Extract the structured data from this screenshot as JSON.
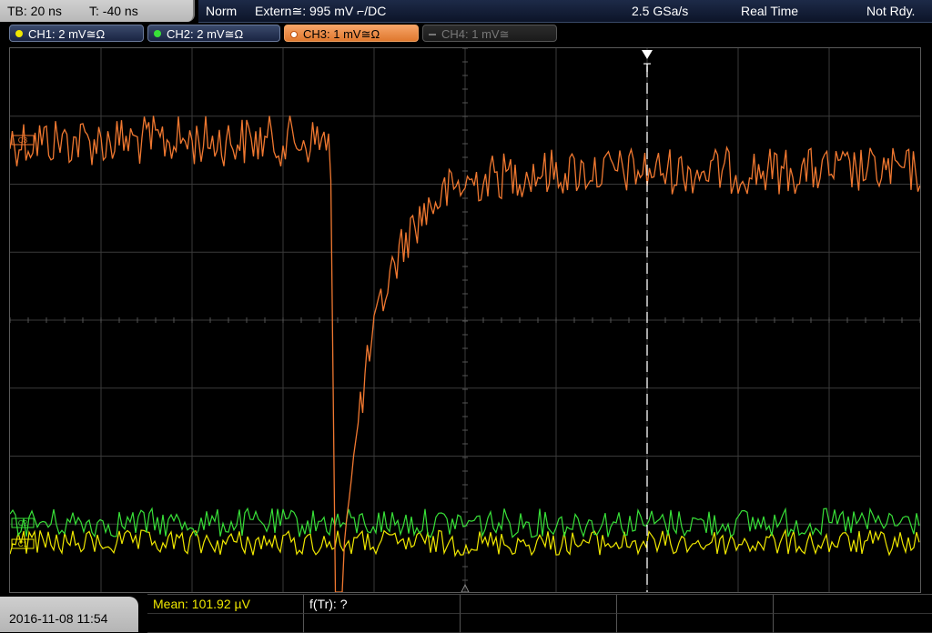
{
  "topbar": {
    "tb_label": "TB: 20 ns",
    "t_label": "T: -40 ns",
    "trigger_mode": "Norm",
    "trigger_source": "Extern≅: 995 mV ⌐/DC",
    "sample_rate": "2.5 GSa/s",
    "acq_mode": "Real Time",
    "status": "Not Rdy."
  },
  "channels": [
    {
      "label": "CH1: 2 mV≅Ω",
      "color": "#f0e800",
      "state": "on"
    },
    {
      "label": "CH2: 2 mV≅Ω",
      "color": "#38e038",
      "state": "on"
    },
    {
      "label": "CH3: 1 mV≅Ω",
      "color": "#f07830",
      "state": "active"
    },
    {
      "label": "CH4: 1 mV≅",
      "color": "#777777",
      "state": "off"
    }
  ],
  "markers": {
    "trigger_letter": "T",
    "ch3_marker": "C3",
    "ch2_marker": "C2",
    "ch1_marker": "C1"
  },
  "colors": {
    "ch1": "#f0e800",
    "ch2": "#38e038",
    "ch3": "#f07830",
    "grid": "#3a3a3a"
  },
  "bottom": {
    "datetime": "2016-11-08 11:54",
    "mean_label": "Mean: 101.92 µV",
    "freq_label": "f(Tr): ?"
  }
}
